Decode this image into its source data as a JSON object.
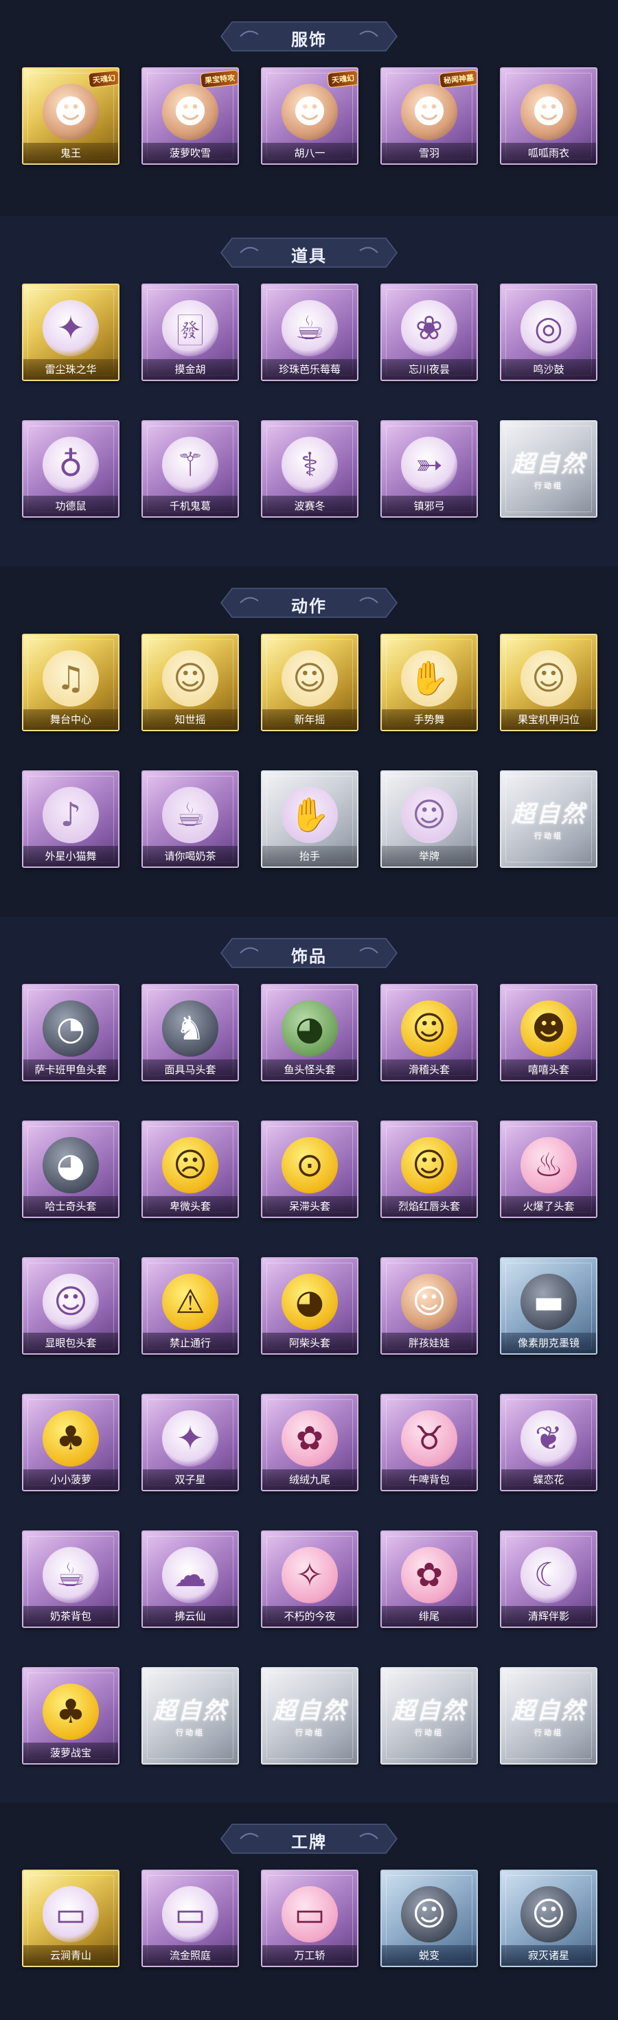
{
  "sections": [
    {
      "title": "服饰",
      "items": [
        {
          "label": "鬼王",
          "rarity": "gold",
          "icon": "ghost-king-skin-icon",
          "glyph": "☻",
          "art": "skin",
          "tag": "天魂幻"
        },
        {
          "label": "菠萝吹雪",
          "rarity": "purple",
          "icon": "pineapple-skin-icon",
          "glyph": "☻",
          "art": "skin",
          "tag": "果宝特攻"
        },
        {
          "label": "胡八一",
          "rarity": "purple",
          "icon": "hu-bayi-skin-icon",
          "glyph": "☻",
          "art": "skin",
          "tag": "天魂幻"
        },
        {
          "label": "雪羽",
          "rarity": "purple",
          "icon": "snow-feather-skin-icon",
          "glyph": "☻",
          "art": "skin",
          "tag": "秘闻神墓"
        },
        {
          "label": "呱呱雨衣",
          "rarity": "purple",
          "icon": "frog-raincoat-skin-icon",
          "glyph": "☻",
          "art": "skin",
          "tag": ""
        }
      ]
    },
    {
      "title": "道具",
      "items": [
        {
          "label": "雷尘珠之华",
          "rarity": "gold",
          "icon": "thunder-pearl-icon",
          "glyph": "✦",
          "art": "prop"
        },
        {
          "label": "摸金胡",
          "rarity": "purple",
          "icon": "mahjong-tile-icon",
          "glyph": "🀅",
          "art": "prop"
        },
        {
          "label": "珍珠芭乐莓莓",
          "rarity": "purple",
          "icon": "bubble-tea-icon",
          "glyph": "☕",
          "art": "prop"
        },
        {
          "label": "忘川夜昙",
          "rarity": "purple",
          "icon": "night-lotus-icon",
          "glyph": "❀",
          "art": "prop"
        },
        {
          "label": "鸣沙鼓",
          "rarity": "purple",
          "icon": "sand-drum-icon",
          "glyph": "◎",
          "art": "prop"
        },
        {
          "label": "功德鼠",
          "rarity": "purple",
          "icon": "merit-hamster-icon",
          "glyph": "♁",
          "art": "prop"
        },
        {
          "label": "千机鬼葛",
          "rarity": "purple",
          "icon": "mech-staff-icon",
          "glyph": "⚚",
          "art": "prop"
        },
        {
          "label": "波赛冬",
          "rarity": "purple",
          "icon": "trident-staff-icon",
          "glyph": "⚕",
          "art": "prop"
        },
        {
          "label": "镇邪弓",
          "rarity": "purple",
          "icon": "bow-icon",
          "glyph": "➳",
          "art": "prop"
        },
        {
          "label": "",
          "rarity": "gray",
          "icon": "locked-placeholder-icon",
          "glyph": "",
          "art": "none",
          "placeholder": "超自然",
          "placeholder_sub": "行动组"
        }
      ]
    },
    {
      "title": "动作",
      "items": [
        {
          "label": "舞台中心",
          "rarity": "gold",
          "icon": "dance-pose-icon",
          "glyph": "♫",
          "art": "emote"
        },
        {
          "label": "知世摇",
          "rarity": "gold",
          "icon": "wave-pose-icon",
          "glyph": "☺",
          "art": "emote"
        },
        {
          "label": "新年摇",
          "rarity": "gold",
          "icon": "new-year-pose-icon",
          "glyph": "☺",
          "art": "emote"
        },
        {
          "label": "手势舞",
          "rarity": "gold",
          "icon": "gesture-dance-icon",
          "glyph": "✋",
          "art": "emote"
        },
        {
          "label": "果宝机甲归位",
          "rarity": "gold",
          "icon": "mech-pose-icon",
          "glyph": "☺",
          "art": "emote"
        },
        {
          "label": "外星小猫舞",
          "rarity": "purple",
          "icon": "alien-cat-dance-icon",
          "glyph": "♪",
          "art": "emote-p"
        },
        {
          "label": "请你喝奶茶",
          "rarity": "purple",
          "icon": "milk-tea-pose-icon",
          "glyph": "☕",
          "art": "emote-p"
        },
        {
          "label": "抬手",
          "rarity": "gray",
          "icon": "raise-hand-icon",
          "glyph": "✋",
          "art": "emote-p"
        },
        {
          "label": "举牌",
          "rarity": "gray",
          "icon": "hold-sign-icon",
          "glyph": "☺",
          "art": "emote-p"
        },
        {
          "label": "",
          "rarity": "gray",
          "icon": "locked-placeholder-icon",
          "glyph": "",
          "art": "none",
          "placeholder": "超自然",
          "placeholder_sub": "行动组"
        }
      ]
    },
    {
      "title": "饰品",
      "items": [
        {
          "label": "萨卡班甲鱼头套",
          "rarity": "purple",
          "icon": "fish-head-icon",
          "glyph": "◔",
          "art": "dark"
        },
        {
          "label": "面具马头套",
          "rarity": "purple",
          "icon": "horse-head-icon",
          "glyph": "♞",
          "art": "dark"
        },
        {
          "label": "鱼头怪头套",
          "rarity": "purple",
          "icon": "fish-monster-head-icon",
          "glyph": "◕",
          "art": "mask"
        },
        {
          "label": "滑稽头套",
          "rarity": "purple",
          "icon": "funny-face-icon",
          "glyph": "☺",
          "art": "face"
        },
        {
          "label": "嘻嘻头套",
          "rarity": "purple",
          "icon": "grin-face-icon",
          "glyph": "☻",
          "art": "face"
        },
        {
          "label": "哈士奇头套",
          "rarity": "purple",
          "icon": "husky-head-icon",
          "glyph": "◕",
          "art": "dark"
        },
        {
          "label": "卑微头套",
          "rarity": "purple",
          "icon": "humble-face-icon",
          "glyph": "☹",
          "art": "face"
        },
        {
          "label": "呆滞头套",
          "rarity": "purple",
          "icon": "dazed-face-icon",
          "glyph": "⊙",
          "art": "face"
        },
        {
          "label": "烈焰红唇头套",
          "rarity": "purple",
          "icon": "red-lips-head-icon",
          "glyph": "☺",
          "art": "face"
        },
        {
          "label": "火爆了头套",
          "rarity": "purple",
          "icon": "fire-head-icon",
          "glyph": "♨",
          "art": "pink"
        },
        {
          "label": "显眼包头套",
          "rarity": "purple",
          "icon": "show-off-head-icon",
          "glyph": "☺",
          "art": "prop"
        },
        {
          "label": "禁止通行",
          "rarity": "purple",
          "icon": "traffic-cone-icon",
          "glyph": "⚠",
          "art": "face"
        },
        {
          "label": "阿柴头套",
          "rarity": "purple",
          "icon": "shiba-head-icon",
          "glyph": "◕",
          "art": "face"
        },
        {
          "label": "胖孩娃娃",
          "rarity": "purple",
          "icon": "chubby-doll-icon",
          "glyph": "☺",
          "art": "skin"
        },
        {
          "label": "像素朋克墨镜",
          "rarity": "blue",
          "icon": "pixel-sunglasses-icon",
          "glyph": "▬",
          "art": "dark"
        },
        {
          "label": "小小菠萝",
          "rarity": "purple",
          "icon": "little-pineapple-icon",
          "glyph": "♣",
          "art": "face"
        },
        {
          "label": "双子星",
          "rarity": "purple",
          "icon": "gemini-star-icon",
          "glyph": "✦",
          "art": "prop"
        },
        {
          "label": "绒绒九尾",
          "rarity": "purple",
          "icon": "nine-tail-fox-icon",
          "glyph": "✿",
          "art": "pink"
        },
        {
          "label": "牛啤背包",
          "rarity": "purple",
          "icon": "beer-backpack-icon",
          "glyph": "♉",
          "art": "pink"
        },
        {
          "label": "蝶恋花",
          "rarity": "purple",
          "icon": "butterfly-flower-icon",
          "glyph": "❦",
          "art": "prop"
        },
        {
          "label": "奶茶背包",
          "rarity": "purple",
          "icon": "milk-tea-backpack-icon",
          "glyph": "☕",
          "art": "prop"
        },
        {
          "label": "拂云仙",
          "rarity": "purple",
          "icon": "cloud-fairy-icon",
          "glyph": "☁",
          "art": "prop"
        },
        {
          "label": "不朽的今夜",
          "rarity": "purple",
          "icon": "immortal-night-icon",
          "glyph": "✧",
          "art": "pink"
        },
        {
          "label": "绯尾",
          "rarity": "purple",
          "icon": "crimson-tail-icon",
          "glyph": "✿",
          "art": "pink"
        },
        {
          "label": "清辉伴影",
          "rarity": "purple",
          "icon": "moonlight-shadow-icon",
          "glyph": "☾",
          "art": "prop"
        },
        {
          "label": "菠萝战宝",
          "rarity": "purple",
          "icon": "pineapple-warrior-icon",
          "glyph": "♣",
          "art": "face"
        },
        {
          "label": "",
          "rarity": "gray",
          "icon": "locked-placeholder-icon",
          "glyph": "",
          "art": "none",
          "placeholder": "超自然",
          "placeholder_sub": "行动组"
        },
        {
          "label": "",
          "rarity": "gray",
          "icon": "locked-placeholder-icon",
          "glyph": "",
          "art": "none",
          "placeholder": "超自然",
          "placeholder_sub": "行动组"
        },
        {
          "label": "",
          "rarity": "gray",
          "icon": "locked-placeholder-icon",
          "glyph": "",
          "art": "none",
          "placeholder": "超自然",
          "placeholder_sub": "行动组"
        },
        {
          "label": "",
          "rarity": "gray",
          "icon": "locked-placeholder-icon",
          "glyph": "",
          "art": "none",
          "placeholder": "超自然",
          "placeholder_sub": "行动组"
        }
      ]
    },
    {
      "title": "工牌",
      "items": [
        {
          "label": "云涧青山",
          "rarity": "gold",
          "icon": "cloud-mountain-badge-icon",
          "glyph": "▭",
          "art": "prop"
        },
        {
          "label": "流金照庭",
          "rarity": "purple",
          "icon": "golden-court-badge-icon",
          "glyph": "▭",
          "art": "prop"
        },
        {
          "label": "万工轿",
          "rarity": "purple",
          "icon": "sedan-chair-badge-icon",
          "glyph": "▭",
          "art": "pink"
        },
        {
          "label": "蜕变",
          "rarity": "blue",
          "icon": "transform-badge-icon",
          "glyph": "☺",
          "art": "dark"
        },
        {
          "label": "寂灭诸星",
          "rarity": "blue",
          "icon": "silent-stars-badge-icon",
          "glyph": "☺",
          "art": "dark"
        }
      ]
    }
  ],
  "colors": {
    "gold": "#e8c95a",
    "purple": "#b88fd0",
    "gray": "#cfd3da",
    "blue": "#97b4cf",
    "background": "#141a2a",
    "banner": "#2c3553"
  }
}
